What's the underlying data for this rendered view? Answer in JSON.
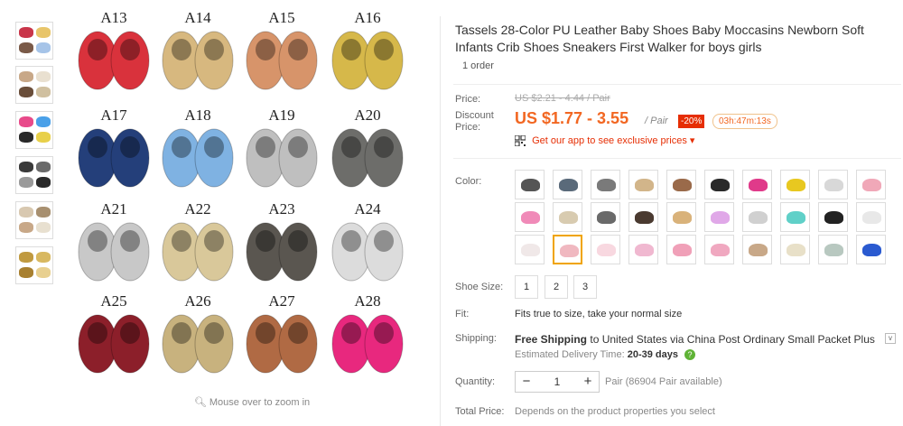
{
  "gallery": {
    "zoom_hint": "Mouse over to zoom in",
    "thumbnails": [
      {
        "name": "thumbnail-1",
        "colors": [
          "#c9364a",
          "#e8c56a",
          "#7a5a48",
          "#a6c4e8"
        ]
      },
      {
        "name": "thumbnail-2",
        "colors": [
          "#c8a888",
          "#e9e0d0",
          "#6a4e3a",
          "#d0c0a0"
        ]
      },
      {
        "name": "thumbnail-3",
        "colors": [
          "#e84a8a",
          "#4aa0e8",
          "#2a2a2a",
          "#e8d04a"
        ]
      },
      {
        "name": "thumbnail-4",
        "colors": [
          "#3a3a3a",
          "#6a6a6a",
          "#9a9a9a",
          "#2a2a2a"
        ]
      },
      {
        "name": "thumbnail-5",
        "colors": [
          "#d8c8b0",
          "#a89070",
          "#c8a888",
          "#e8e0d0"
        ]
      },
      {
        "name": "thumbnail-6",
        "colors": [
          "#c09a40",
          "#d8b860",
          "#a88030",
          "#e8d090"
        ]
      }
    ],
    "products": [
      {
        "label": "A13",
        "color": "#d9323c"
      },
      {
        "label": "A14",
        "color": "#d7b87f"
      },
      {
        "label": "A15",
        "color": "#d7946a"
      },
      {
        "label": "A16",
        "color": "#d6b84a"
      },
      {
        "label": "A17",
        "color": "#243f7a"
      },
      {
        "label": "A18",
        "color": "#7fb2e2"
      },
      {
        "label": "A19",
        "color": "#bfbfbf"
      },
      {
        "label": "A20",
        "color": "#6d6d6a"
      },
      {
        "label": "A21",
        "color": "#c8c8c8"
      },
      {
        "label": "A22",
        "color": "#d9c89a"
      },
      {
        "label": "A23",
        "color": "#5a5650"
      },
      {
        "label": "A24",
        "color": "#dcdcdc"
      },
      {
        "label": "A25",
        "color": "#8c1f2a"
      },
      {
        "label": "A26",
        "color": "#c8b27e"
      },
      {
        "label": "A27",
        "color": "#b06a44"
      },
      {
        "label": "A28",
        "color": "#e8287e"
      }
    ]
  },
  "product": {
    "title": "Tassels 28-Color PU Leather Baby Shoes Baby Moccasins Newborn Soft Infants Crib Shoes Sneakers First Walker for boys girls",
    "orders": "1 order"
  },
  "pricing": {
    "price_label": "Price:",
    "old_price": "US $2.21 - 4.44 / Pair",
    "discount_price_label": "Discount Price:",
    "price": "US $1.77 - 3.55",
    "unit": "/ Pair",
    "discount_badge": "-20%",
    "countdown": "03h:47m:13s",
    "app_promo": "Get our app to see exclusive prices ▾",
    "accent_color": "#f26722"
  },
  "color": {
    "label": "Color:",
    "selected_index": 21,
    "swatches": [
      "#555555",
      "#5a6a7a",
      "#7a7a7a",
      "#d2b58a",
      "#9a6a4a",
      "#2a2a2a",
      "#e03a8a",
      "#e8c820",
      "#d8d8d8",
      "#f0a8b8",
      "#f08ab8",
      "#d8cbb0",
      "#6a6a6a",
      "#4a3a30",
      "#d9b27a",
      "#e0a8e8",
      "#d0d0d0",
      "#60d0c8",
      "#222222",
      "#e8e8e8",
      "#f0e8e8",
      "#f0b8c0",
      "#f8d8e0",
      "#f0b8d0",
      "#f0a0b8",
      "#f0a8c0",
      "#c8a888",
      "#e8e0c8",
      "#b8c8c0",
      "#2a5ad0"
    ]
  },
  "size": {
    "label": "Shoe Size:",
    "options": [
      "1",
      "2",
      "3"
    ]
  },
  "fit": {
    "label": "Fit:",
    "value": "Fits true to size, take your normal size"
  },
  "shipping": {
    "label": "Shipping:",
    "free": "Free Shipping",
    "to": "to",
    "country": "United States",
    "via": "via China Post Ordinary Small Packet Plus",
    "dropdown": "v",
    "delivery_label": "Estimated Delivery Time:",
    "delivery_days": "20-39 days",
    "help": "?"
  },
  "quantity": {
    "label": "Quantity:",
    "minus": "−",
    "value": "1",
    "plus": "+",
    "available": "Pair (86904 Pair available)"
  },
  "total": {
    "label": "Total Price:",
    "note": "Depends on the product properties you select"
  }
}
